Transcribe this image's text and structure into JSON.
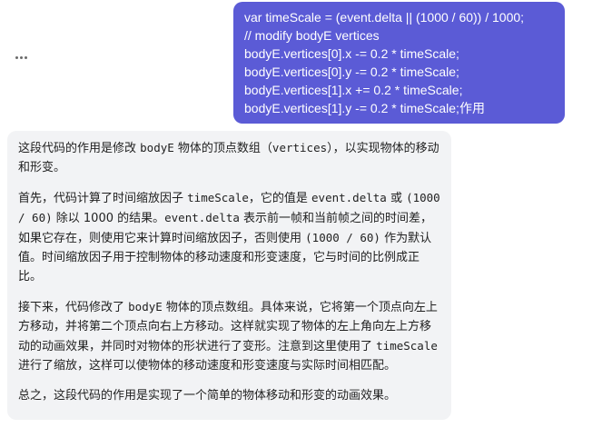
{
  "user_message": {
    "lines": [
      "var timeScale = (event.delta || (1000 / 60)) / 1000;",
      "// modify bodyE vertices",
      "bodyE.vertices[0].x -= 0.2 * timeScale;",
      "bodyE.vertices[0].y -= 0.2 * timeScale;",
      "bodyE.vertices[1].x += 0.2 * timeScale;",
      "bodyE.vertices[1].y -= 0.2 * timeScale;作用"
    ]
  },
  "assistant_message": {
    "p1": {
      "t1": "这段代码的作用是修改 ",
      "c1": "bodyE",
      "t2": " 物体的顶点数组（",
      "c2": "vertices",
      "t3": "），以实现物体的移动和形变。"
    },
    "p2": {
      "t1": "首先，代码计算了时间缩放因子 ",
      "c1": "timeScale",
      "t2": "，它的值是 ",
      "c2": "event.delta",
      "t3": " 或 ",
      "c3": "(1000 / 60)",
      "t4": " 除以 1000 的结果。",
      "c4": "event.delta",
      "t5": " 表示前一帧和当前帧之间的时间差，如果它存在，则使用它来计算时间缩放因子，否则使用 ",
      "c5": "(1000 / 60)",
      "t6": " 作为默认值。时间缩放因子用于控制物体的移动速度和形变速度，它与时间的比例成正比。"
    },
    "p3": {
      "t1": "接下来，代码修改了 ",
      "c1": "bodyE",
      "t2": " 物体的顶点数组。具体来说，它将第一个顶点向左上方移动，并将第二个顶点向右上方移动。这样就实现了物体的左上角向左上方移动的动画效果，并同时对物体的形状进行了变形。注意到这里使用了 ",
      "c2": "timeScale",
      "t3": " 进行了缩放，这样可以使物体的移动速度和形变速度与实际时间相匹配。"
    },
    "p4": {
      "t1": "总之，这段代码的作用是实现了一个简单的物体移动和形变的动画效果。"
    }
  },
  "colors": {
    "user_bubble": "#5b5bd6",
    "assistant_bubble": "#f2f3f5"
  },
  "icons": {
    "more": "more-horizontal-icon"
  }
}
